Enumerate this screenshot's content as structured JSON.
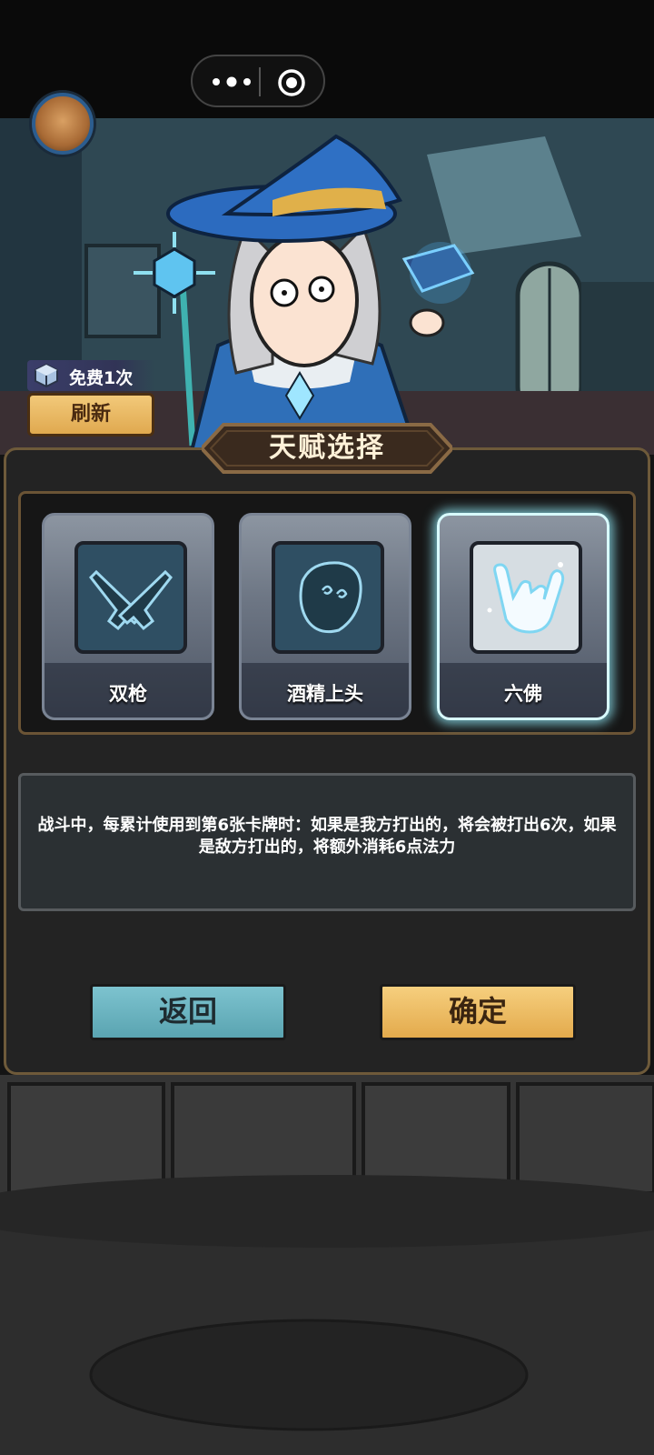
{
  "top_capsule": {
    "more_icon": "more-dots-icon",
    "close_icon": "target-circle-icon"
  },
  "player": {
    "avatar_icon": "character-avatar"
  },
  "refresh": {
    "free_text": "免费1次",
    "icon": "cube-icon",
    "button_label": "刷新"
  },
  "panel": {
    "title": "天赋选择",
    "cards": [
      {
        "label": "双枪",
        "icon": "crossed-pistols-icon",
        "selected": false
      },
      {
        "label": "酒精上头",
        "icon": "dizzy-head-icon",
        "selected": false
      },
      {
        "label": "六佛",
        "icon": "shaka-hand-icon",
        "selected": true
      }
    ],
    "description": "战斗中，每累计使用到第6张卡牌时：如果是我方打出的，将会被打出6次，如果是敌方打出的，将额外消耗6点法力"
  },
  "buttons": {
    "back_label": "返回",
    "confirm_label": "确定"
  },
  "colors": {
    "accent_gold": "#e3aa4c",
    "accent_teal": "#5aa4b1",
    "selected_glow": "#96f0ff"
  }
}
